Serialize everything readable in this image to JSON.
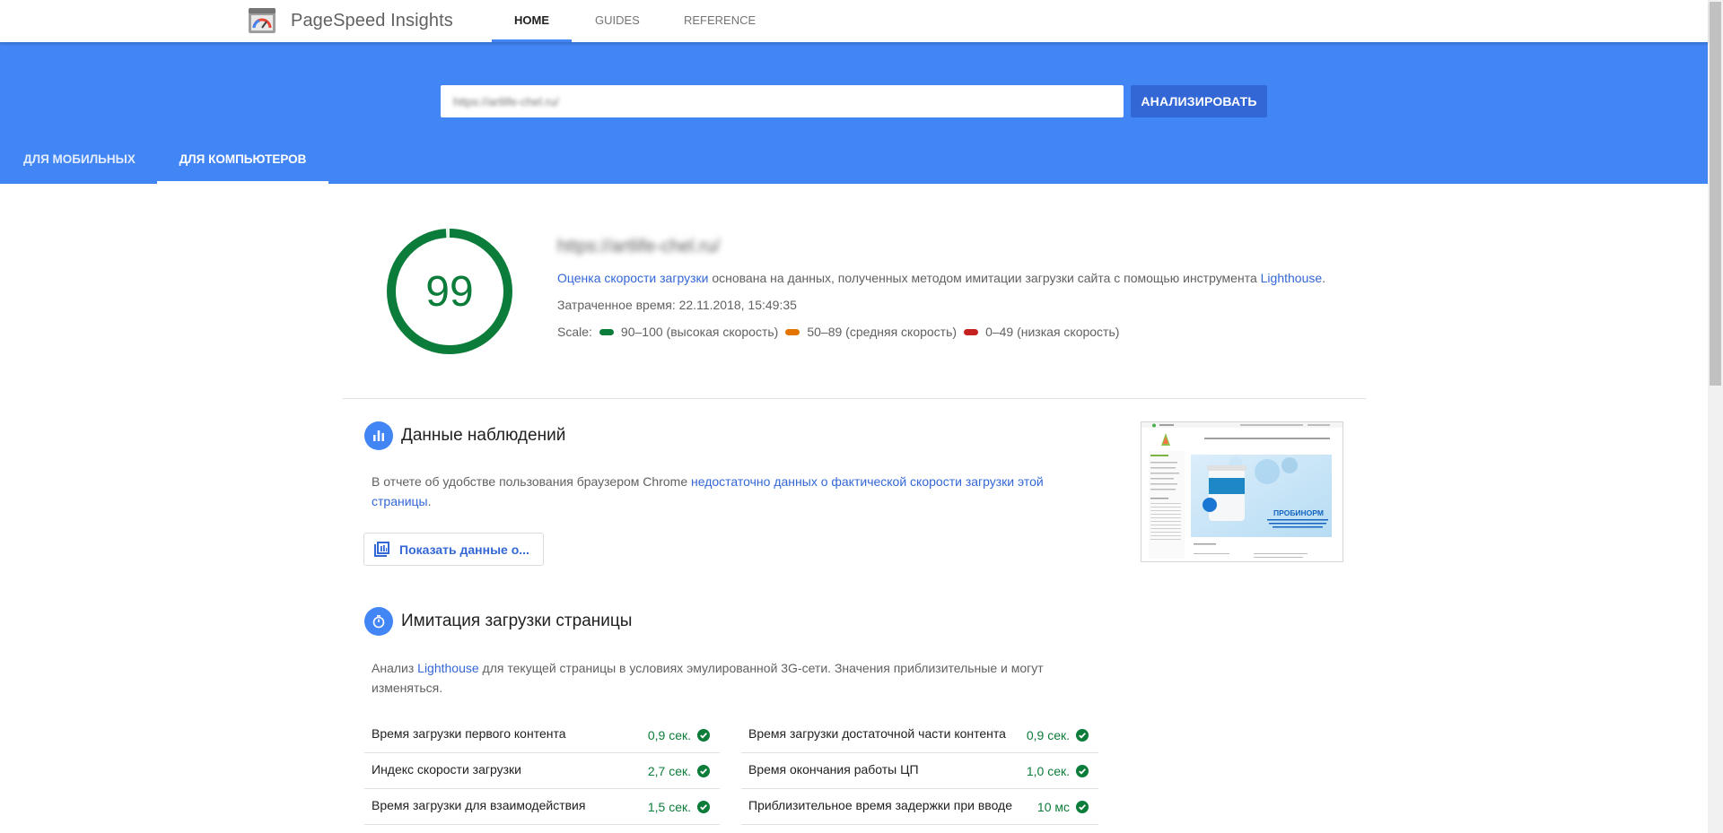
{
  "app": {
    "title": "PageSpeed Insights",
    "nav": [
      "HOME",
      "GUIDES",
      "REFERENCE"
    ],
    "active_nav": "HOME"
  },
  "search": {
    "value": "https://artlife-chel.ru/",
    "button_label": "АНАЛИЗИРОВАТЬ"
  },
  "device_tabs": [
    "ДЛЯ МОБИЛЬНЫХ",
    "ДЛЯ КОМПЬЮТЕРОВ"
  ],
  "active_device": "ДЛЯ КОМПЬЮТЕРОВ",
  "score": {
    "value": 99,
    "url": "https://artlife-chel.ru/",
    "summary_link": "Оценка скорости загрузки",
    "summary_text": " основана на данных, полученных методом имитации загрузки сайта с помощью инструмента ",
    "summary_link2": "Lighthouse",
    "summary_end": ".",
    "elapsed": "Затраченное время: 22.11.2018, 15:49:35",
    "scale_label": "Scale:",
    "scale": [
      {
        "text": "90–100 (высокая скорость)",
        "color": "#0c7c3a"
      },
      {
        "text": "50–89 (средняя скорость)",
        "color": "#e37400"
      },
      {
        "text": "0–49 (низкая скорость)",
        "color": "#c5221f"
      }
    ]
  },
  "field_data": {
    "title": "Данные наблюдений",
    "text_before": "В отчете об удобстве пользования браузером Chrome ",
    "link_line1": "недостаточно данных о фактической скорости загрузки этой",
    "link_line2": "страницы",
    "text_after": ".",
    "button": "Показать данные о..."
  },
  "lab_data": {
    "title": "Имитация загрузки страницы",
    "text_before": "Анализ ",
    "link": "Lighthouse",
    "text_after_line1": " для текущей страницы в условиях эмулированной 3G-сети. Значения приблизительные и могут",
    "text_line2": "изменяться.",
    "metrics_left": [
      {
        "label": "Время загрузки первого контента",
        "value": "0,9 сек."
      },
      {
        "label": "Индекс скорости загрузки",
        "value": "2,7 сек."
      },
      {
        "label": "Время загрузки для взаимодействия",
        "value": "1,5 сек."
      }
    ],
    "metrics_right": [
      {
        "label": "Время загрузки достаточной части контента",
        "value": "0,9 сек."
      },
      {
        "label": "Время окончания работы ЦП",
        "value": "1,0 сек."
      },
      {
        "label": "Приблизительное время задержки при вводе",
        "value": "10 мс"
      }
    ]
  },
  "thumbnail": {
    "banner_title": "ПРОБИНОРМ",
    "banner_sub": "МИКРОКАПСУЛИРОВАННЫЙ КОМПЛЕКС ПРОБИОТИКОВ С ВЫСОКОЙ ЭФФЕКТИВНОСТЬЮ"
  },
  "colors": {
    "accent": "#4285f4",
    "button": "#3367d6",
    "good": "#0c7c3a"
  }
}
